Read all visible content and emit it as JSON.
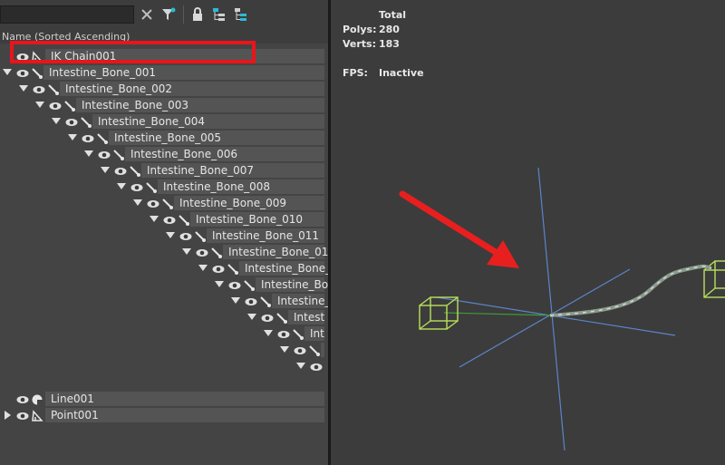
{
  "toolbar": {
    "search_value": "",
    "icons": [
      "clear-search-icon",
      "filter-icon",
      "lock-icon",
      "hierarchy-icon",
      "layers-icon"
    ]
  },
  "column_header": "Name (Sorted Ascending)",
  "scene_tree": [
    {
      "name": "IK Chain001",
      "icon": "ik-chain-icon",
      "expanded": null,
      "highlighted": true
    },
    {
      "name": "Intestine_Bone_001",
      "icon": "bone-icon",
      "expanded": true
    },
    {
      "name": "Intestine_Bone_002",
      "icon": "bone-icon",
      "expanded": true
    },
    {
      "name": "Intestine_Bone_003",
      "icon": "bone-icon",
      "expanded": true
    },
    {
      "name": "Intestine_Bone_004",
      "icon": "bone-icon",
      "expanded": true
    },
    {
      "name": "Intestine_Bone_005",
      "icon": "bone-icon",
      "expanded": true
    },
    {
      "name": "Intestine_Bone_006",
      "icon": "bone-icon",
      "expanded": true
    },
    {
      "name": "Intestine_Bone_007",
      "icon": "bone-icon",
      "expanded": true
    },
    {
      "name": "Intestine_Bone_008",
      "icon": "bone-icon",
      "expanded": true
    },
    {
      "name": "Intestine_Bone_009",
      "icon": "bone-icon",
      "expanded": true
    },
    {
      "name": "Intestine_Bone_010",
      "icon": "bone-icon",
      "expanded": true
    },
    {
      "name": "Intestine_Bone_011",
      "icon": "bone-icon",
      "expanded": true
    },
    {
      "name": "Intestine_Bone_01",
      "icon": "bone-icon",
      "expanded": true
    },
    {
      "name": "Intestine_Bone_",
      "icon": "bone-icon",
      "expanded": true
    },
    {
      "name": "Intestine_Bo",
      "icon": "bone-icon",
      "expanded": true
    },
    {
      "name": "Intestine_",
      "icon": "bone-icon",
      "expanded": true
    },
    {
      "name": "Intest",
      "icon": "bone-icon",
      "expanded": true
    },
    {
      "name": "Int",
      "icon": "bone-icon",
      "expanded": true
    },
    {
      "name": "",
      "icon": "bone-icon",
      "expanded": true
    },
    {
      "name": "",
      "icon": "none",
      "expanded": true
    },
    {
      "name": "Line001",
      "icon": "shape-icon",
      "expanded": null
    },
    {
      "name": "Point001",
      "icon": "point-helper-icon",
      "expanded": false
    }
  ],
  "viewport_stats": {
    "header": "Total",
    "polys_label": "Polys:",
    "polys_value": "280",
    "verts_label": "Verts:",
    "verts_value": "183",
    "fps_label": "FPS:",
    "fps_value": "Inactive"
  },
  "colors": {
    "highlight_box": "#e8151b",
    "annotation_arrow": "#e81f1f",
    "helper_box": "#b9e05a",
    "axis_blue": "#5b85c9",
    "axis_green": "#3f9b3f"
  }
}
